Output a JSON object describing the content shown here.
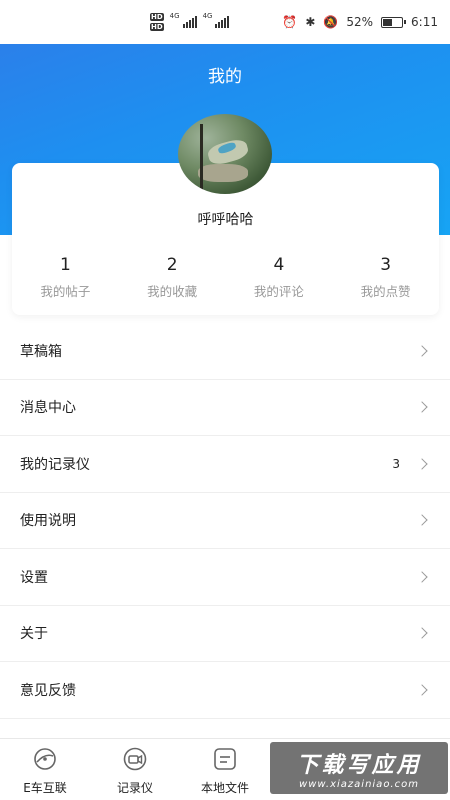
{
  "status_bar": {
    "network_label": "4G",
    "battery_percent": "52%",
    "battery_level": 0.52,
    "time": "6:11"
  },
  "header": {
    "title": "我的"
  },
  "profile": {
    "username": "呼呼哈哈",
    "stats": [
      {
        "value": "1",
        "label": "我的帖子"
      },
      {
        "value": "2",
        "label": "我的收藏"
      },
      {
        "value": "4",
        "label": "我的评论"
      },
      {
        "value": "3",
        "label": "我的点赞"
      }
    ]
  },
  "menu": {
    "items": [
      {
        "label": "草稿箱"
      },
      {
        "label": "消息中心"
      },
      {
        "label": "我的记录仪",
        "badge": "3"
      },
      {
        "label": "使用说明"
      },
      {
        "label": "设置"
      },
      {
        "label": "关于"
      },
      {
        "label": "意见反馈"
      }
    ]
  },
  "bottom_nav": {
    "items": [
      {
        "label": "E车互联",
        "icon": "steering-wheel-icon"
      },
      {
        "label": "记录仪",
        "icon": "camera-recorder-icon"
      },
      {
        "label": "本地文件",
        "icon": "file-icon"
      }
    ]
  },
  "watermark": {
    "title": "下载写应用",
    "url": "www.xiazainiao.com"
  },
  "colors": {
    "header_gradient_start": "#2f7be8",
    "header_gradient_end": "#17a4f4"
  }
}
